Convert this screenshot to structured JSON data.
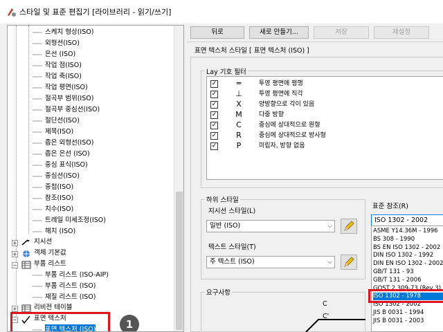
{
  "window": {
    "title": "스타일 및 표준 편집기 [라이브러리 - 읽기/쓰기]"
  },
  "tree": {
    "items": [
      {
        "label": "스케치 형상(ISO)"
      },
      {
        "label": "외형선(ISO)"
      },
      {
        "label": "은선 (ISO)"
      },
      {
        "label": "작업 점(ISO)"
      },
      {
        "label": "작업 축(ISO)"
      },
      {
        "label": "작업 평면(ISO)"
      },
      {
        "label": "절곡부 범위(ISO)"
      },
      {
        "label": "절곡부 중심선(ISO)"
      },
      {
        "label": "절단선(ISO)"
      },
      {
        "label": "제목(ISO)"
      },
      {
        "label": "좁은 외형선(ISO)"
      },
      {
        "label": "좁은 은선 (ISO)"
      },
      {
        "label": "중심 표식(ISO)"
      },
      {
        "label": "중심선(ISO)"
      },
      {
        "label": "중첩(ISO)"
      },
      {
        "label": "참조(ISO)"
      },
      {
        "label": "치수(ISO)"
      },
      {
        "label": "트레일 미세조정(ISO)"
      },
      {
        "label": "해치 (ISO)"
      }
    ],
    "leader": "지시선",
    "object_defaults": "객체 기본값",
    "parts_list": "부품 리스트",
    "parts_list_children": [
      {
        "label": "부품 리스트 (ISO-AIP)"
      },
      {
        "label": "부품 리스트 (ISO)"
      },
      {
        "label": "재질 리스트 (ISO)"
      }
    ],
    "revision_table": "리비전 테이블",
    "surface_texture": "표면 텍스처",
    "surface_texture_child": "표면 텍스처 (ISO)",
    "badge": "1"
  },
  "toolbar": {
    "back": "뒤로",
    "new": "새로 만들기...",
    "save": "저장",
    "reset": "재설정"
  },
  "style_header": "표면 텍스처 스타일 [ 표면 텍스처 (ISO) ]",
  "lay_filter": {
    "title": "Lay 기호 필터",
    "rows": [
      {
        "checked": "✓",
        "symbol": "═",
        "text": "투영 평면에 평행"
      },
      {
        "checked": "✓",
        "symbol": "⊥",
        "text": "투영 평면에 직각"
      },
      {
        "checked": "✓",
        "symbol": "X",
        "text": "양방향으로 각이 있음"
      },
      {
        "checked": "✓",
        "symbol": "M",
        "text": "다중 방향"
      },
      {
        "checked": "✓",
        "symbol": "C",
        "text": "중심에 상대적으로 원형"
      },
      {
        "checked": "✓",
        "symbol": "R",
        "text": "중심에 상대적으로 방사형"
      },
      {
        "checked": "✓",
        "symbol": "P",
        "text": "미립자, 방향 없음"
      }
    ]
  },
  "substyles": {
    "title": "하위 스타일",
    "leader_label": "지시선 스타일(L)",
    "leader_value": "일반 (ISO)",
    "text_label": "텍스트 스타일(T)",
    "text_value": "주 텍스트 (ISO)"
  },
  "standard_ref": {
    "label": "표준 참조(R)",
    "value": "ISO 1302 - 2002",
    "options": [
      "ASME Y14.36M - 1996",
      "BS 308 - 1990",
      "BS EN ISO 1302 - 2002",
      "DIN ISO 1302 - 1992",
      "DIN EN ISO 1302 - 2002",
      "GB/T 131 - 93",
      "GB/T 131 - 2006",
      "GOST 2.309-73 (Rev 3)",
      "ISO 1302 - 1978",
      "ISO 1302 - 2002",
      "JIS B 0031 - 1994",
      "JIS B 0031 - 2003"
    ],
    "selected_option": "ISO 1302 - 1978"
  },
  "requirements": {
    "title": "요구사항",
    "c_label": "C",
    "c_prime_label": "C'"
  },
  "colors": {
    "selection": "#0078d7",
    "highlight": "#e0141e"
  }
}
